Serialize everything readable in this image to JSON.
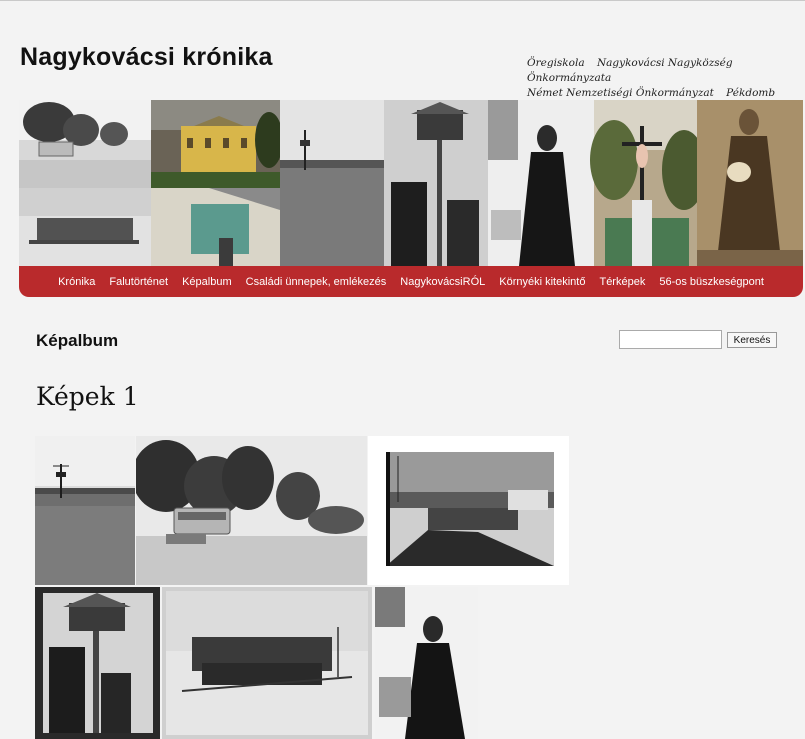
{
  "site": {
    "title": "Nagykovácsi krónika"
  },
  "top_links": [
    "Öregiskola",
    "Nagykovácsi Nagyközség Önkormányzata",
    "Német Nemzetiségi Önkormányzat",
    "Pékdomb"
  ],
  "nav": {
    "items": [
      "Krónika",
      "Falutörténet",
      "Képalbum",
      "Családi ünnepek, emlékezés",
      "NagykovácsiRÓL",
      "Környéki kitekintő",
      "Térképek",
      "56-os büszkeségpont"
    ]
  },
  "colors": {
    "nav_bg": "#b92a2c",
    "page_bg": "#f3f3f3"
  },
  "page": {
    "heading": "Képalbum"
  },
  "search": {
    "button_label": "Keresés",
    "value": ""
  },
  "album": {
    "title": "Képek 1"
  },
  "banner": {
    "photos": [
      "landscape-bus-photo",
      "yellow-villa-photo",
      "skiers-group-photo",
      "house-facade-photo",
      "weather-station-field-photo",
      "birdhouse-men-photo",
      "old-woman-in-black-photo",
      "crucifix-photo",
      "woman-with-flowers-photo"
    ]
  },
  "gallery": {
    "photos": [
      "weather-station-field-photo",
      "bus-and-trees-photo",
      "village-bridge-winter-photo",
      "birdhouse-men-photo",
      "skiers-group-photo",
      "old-woman-in-black-photo"
    ]
  }
}
